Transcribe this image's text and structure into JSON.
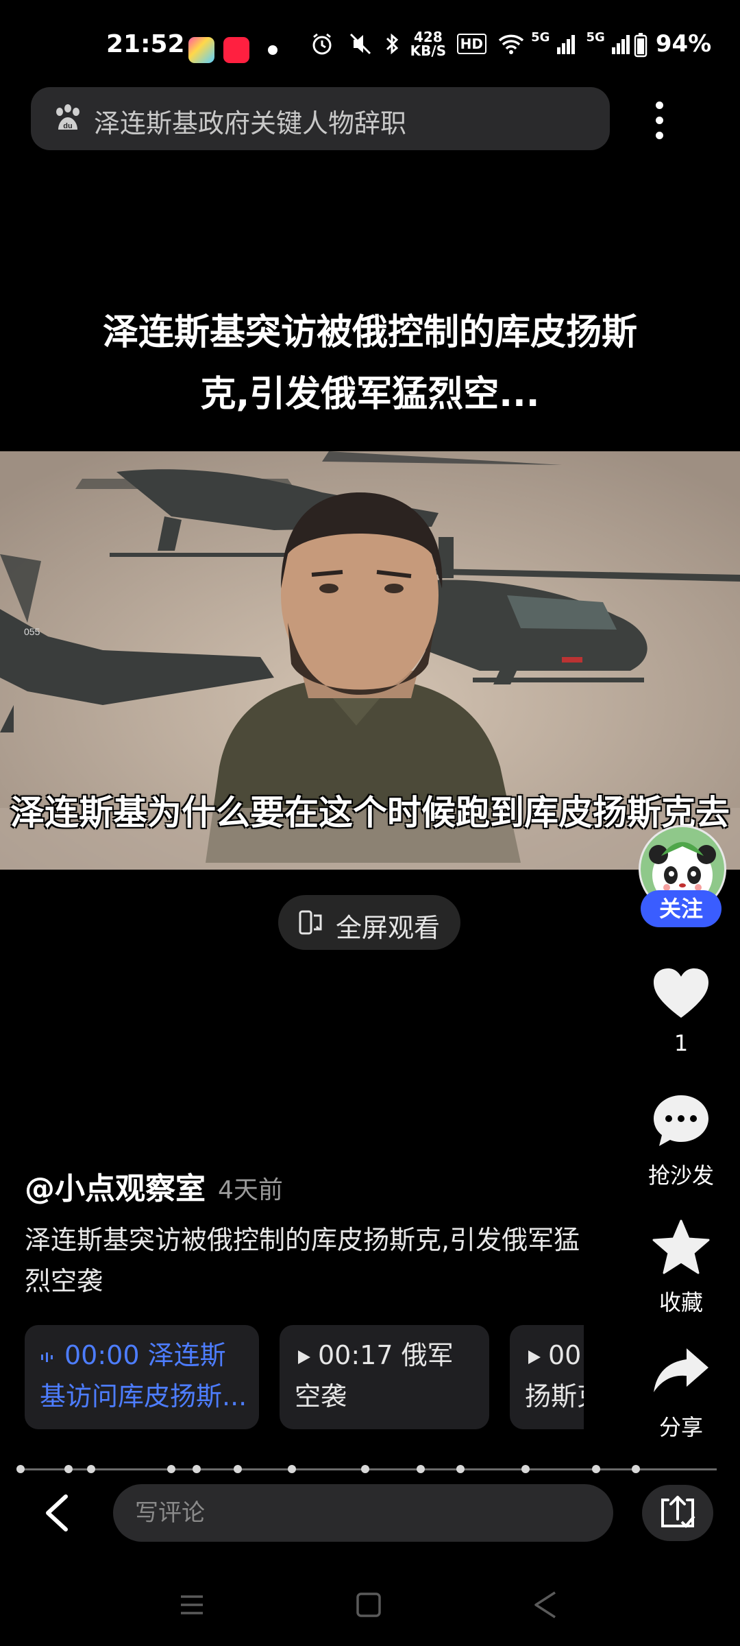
{
  "status_bar": {
    "time": "21:52",
    "network_speed": "428\nKB/S",
    "signal_1": "5G",
    "signal_2": "5G",
    "battery": "94%"
  },
  "search": {
    "query": "泽连斯基政府关键人物辞职"
  },
  "video": {
    "title": "泽连斯基突访被俄控制的库皮扬斯克,引发俄军猛烈空...",
    "subtitle": "泽连斯基为什么要在这个时候跑到库皮扬斯克去",
    "heli_marking": "055",
    "fullscreen_label": "全屏观看"
  },
  "author": {
    "follow_label": "关注",
    "name": "@小点观察室",
    "post_time": "4天前"
  },
  "actions": {
    "like_count": "1",
    "comment_label": "抢沙发",
    "favorite_label": "收藏",
    "share_label": "分享"
  },
  "post": {
    "description": "泽连斯基突访被俄控制的库皮扬斯克,引发俄军猛烈空袭"
  },
  "chapters": [
    {
      "time": "00:00",
      "title": "泽连斯基访问库皮扬斯...",
      "line1": "00:00 泽连斯",
      "line2": "基访问库皮扬斯...",
      "active": true
    },
    {
      "time": "00:17",
      "title": "俄军空袭",
      "line1": "00:17 俄军",
      "line2": "空袭",
      "active": false
    },
    {
      "time": "00",
      "title": "扬斯克",
      "line1": "00",
      "line2": "扬斯克",
      "active": false
    }
  ],
  "comment": {
    "placeholder": "写评论"
  },
  "colors": {
    "background": "#000000",
    "accent_blue": "#3a5dff",
    "chapter_active": "#4d7dff",
    "panel": "#2a2a2c"
  },
  "icons": [
    "search-icon",
    "more-icon",
    "fullscreen-icon",
    "heart-icon",
    "comment-icon",
    "star-icon",
    "share-icon",
    "back-icon",
    "screen-share-icon",
    "menu-icon",
    "home-icon",
    "back-triangle-icon"
  ]
}
